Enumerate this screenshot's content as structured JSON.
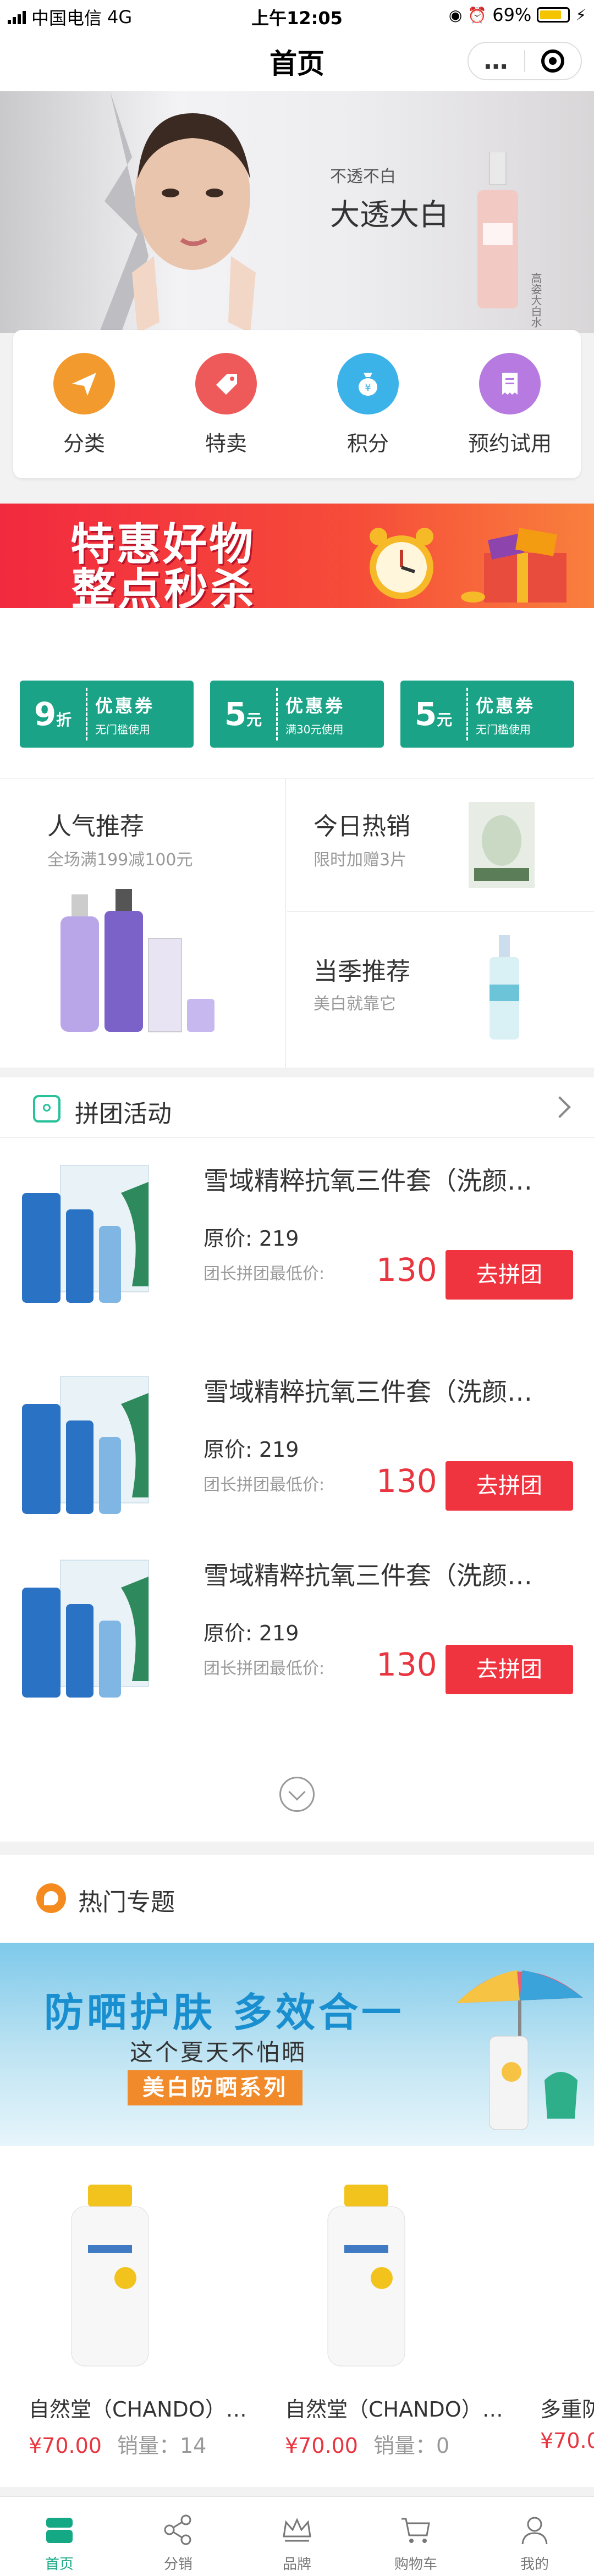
{
  "status_bar": {
    "carrier": "中国电信",
    "network": "4G",
    "time": "上午12:05",
    "battery": "69%"
  },
  "nav": {
    "title": "首页",
    "more_icon": "…",
    "target_icon": "target-icon"
  },
  "hero": {
    "tagline": "不透不白",
    "headline": "大透大白",
    "side_text": "高姿大白水"
  },
  "quick_menu": [
    {
      "label": "分类",
      "icon": "send-icon",
      "color": "#f29a2e"
    },
    {
      "label": "特卖",
      "icon": "tag-icon",
      "color": "#ee5a5a"
    },
    {
      "label": "积分",
      "icon": "money-bag-icon",
      "color": "#3bb3e8"
    },
    {
      "label": "预约试用",
      "icon": "receipt-icon",
      "color": "#b67ae0"
    }
  ],
  "seckill": {
    "line1": "特惠好物",
    "line2": "整点秒杀"
  },
  "coupons": [
    {
      "amount": "9",
      "unit": "折",
      "title": "优惠券",
      "desc": "无门槛使用"
    },
    {
      "amount": "5",
      "unit": "元",
      "title": "优惠券",
      "desc": "满30元使用"
    },
    {
      "amount": "5",
      "unit": "元",
      "title": "优惠券",
      "desc": "无门槛使用"
    }
  ],
  "recommend": {
    "left": {
      "title": "人气推荐",
      "sub": "全场满199减100元"
    },
    "right_top": {
      "title": "今日热销",
      "sub": "限时加赠3片"
    },
    "right_bottom": {
      "title": "当季推荐",
      "sub": "美白就靠它"
    }
  },
  "group_buy": {
    "title": "拼团活动",
    "items": [
      {
        "name": "雪域精粹抗氧三件套（洗颜…",
        "orig": "原价: 219",
        "leader_label": "团长拼团最低价:",
        "price": "130",
        "button": "去拼团"
      },
      {
        "name": "雪域精粹抗氧三件套（洗颜…",
        "orig": "原价: 219",
        "leader_label": "团长拼团最低价:",
        "price": "130",
        "button": "去拼团"
      },
      {
        "name": "雪域精粹抗氧三件套（洗颜…",
        "orig": "原价: 219",
        "leader_label": "团长拼团最低价:",
        "price": "130",
        "button": "去拼团"
      }
    ]
  },
  "hot_topics": {
    "title": "热门专题",
    "banner": {
      "title": "防晒护肤  多效合一",
      "sub": "这个夏天不怕晒",
      "tag": "美白防晒系列"
    },
    "products": [
      {
        "name": "自然堂（CHANDO）…",
        "price": "¥70.00",
        "sales": "销量：14"
      },
      {
        "name": "自然堂（CHANDO）…",
        "price": "¥70.00",
        "sales": "销量：0"
      },
      {
        "name": "多重防",
        "price": "¥70.0",
        "sales": ""
      }
    ]
  },
  "tabbar": [
    {
      "label": "首页",
      "icon": "home-icon",
      "active": true
    },
    {
      "label": "分销",
      "icon": "share-icon",
      "active": false
    },
    {
      "label": "品牌",
      "icon": "crown-icon",
      "active": false
    },
    {
      "label": "购物车",
      "icon": "cart-icon",
      "active": false
    },
    {
      "label": "我的",
      "icon": "user-icon",
      "active": false
    }
  ]
}
